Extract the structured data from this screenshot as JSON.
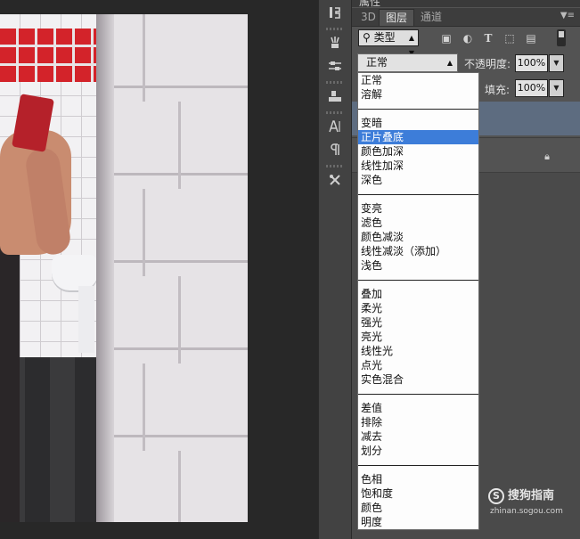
{
  "panel": {
    "title": "属性",
    "tabs": [
      "3D",
      "图层",
      "通道"
    ],
    "active_tab": "图层"
  },
  "filter": {
    "kind_label": "类型",
    "icons": [
      "image-filter-icon",
      "adjustment-filter-icon",
      "type-filter-icon",
      "shape-filter-icon",
      "smart-object-filter-icon"
    ]
  },
  "blend": {
    "current": "正常",
    "opacity_label": "不透明度:",
    "opacity_value": "100%",
    "fill_label": "填充:",
    "fill_value": "100%"
  },
  "blend_modes": {
    "selected": "正片叠底",
    "groups": [
      [
        "正常",
        "溶解"
      ],
      [
        "变暗",
        "正片叠底",
        "颜色加深",
        "线性加深",
        "深色"
      ],
      [
        "变亮",
        "滤色",
        "颜色减淡",
        "线性减淡（添加）",
        "浅色"
      ],
      [
        "叠加",
        "柔光",
        "强光",
        "亮光",
        "线性光",
        "点光",
        "实色混合"
      ],
      [
        "差值",
        "排除",
        "减去",
        "划分"
      ],
      [
        "色相",
        "饱和度",
        "颜色",
        "明度"
      ]
    ]
  },
  "tool_strip": {
    "buttons": [
      "history-icon",
      "brush-preset-icon",
      "brush-settings-icon",
      "clone-source-icon",
      "character-icon",
      "paragraph-icon",
      "tool-preset-icon"
    ]
  },
  "watermark": {
    "brand": "搜狗指南",
    "url": "zhinan.sogou.com"
  }
}
